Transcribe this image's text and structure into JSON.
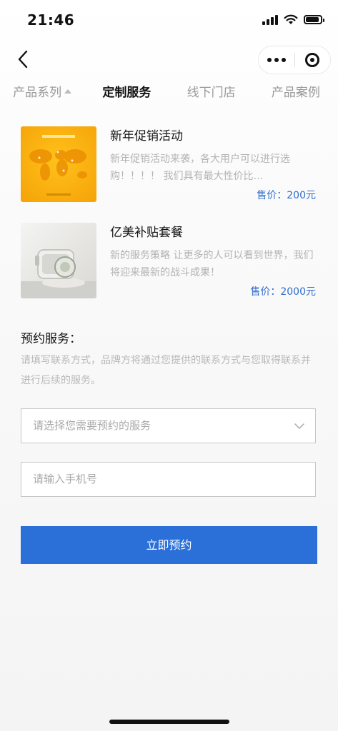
{
  "status_bar": {
    "time": "21:46"
  },
  "tabs": [
    {
      "label": "产品系列",
      "active": false,
      "has_sort_caret": true
    },
    {
      "label": "定制服务",
      "active": true
    },
    {
      "label": "线下门店",
      "active": false
    },
    {
      "label": "产品案例",
      "active": false
    }
  ],
  "products": [
    {
      "title": "新年促销活动",
      "desc": "新年促销活动来袭，各大用户可以进行选购！！！！ 我们具有最大性价比…",
      "price": "售价：200元",
      "thumb_icon": "world-map-infographic-image"
    },
    {
      "title": "亿美补贴套餐",
      "desc": "新的服务策略 让更多的人可以看到世界，我们将迎来最新的战斗成果！",
      "price": "售价：2000元",
      "thumb_icon": "camera-product-image"
    }
  ],
  "booking": {
    "title": "预约服务：",
    "desc": "请填写联系方式，品牌方将通过您提供的联系方式与您取得联系并进行后续的服务。",
    "service_select": {
      "placeholder": "请选择您需要预约的服务"
    },
    "phone_input": {
      "placeholder": "请输入手机号"
    },
    "submit_label": "立即预约"
  },
  "colors": {
    "accent": "#2b6fd8",
    "price": "#2f6ecb"
  }
}
